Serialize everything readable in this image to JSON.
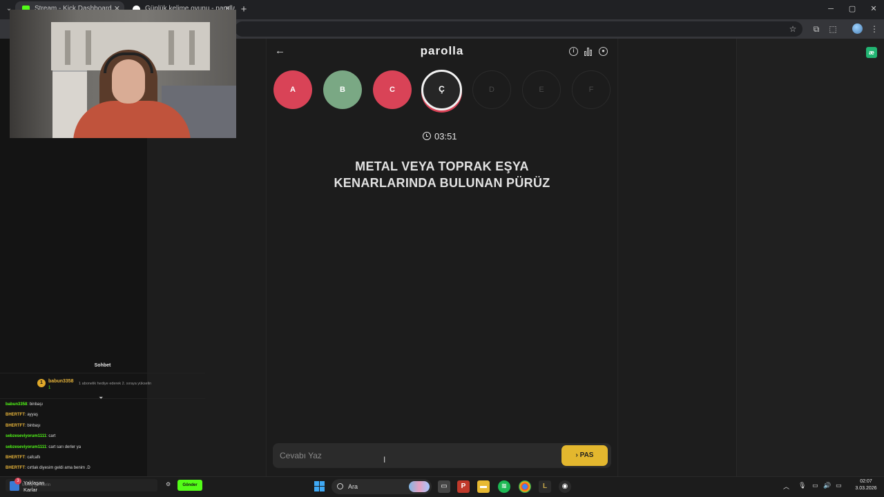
{
  "browser": {
    "tabs": [
      {
        "title": "Stream - Kick Dashboard",
        "favicon_color": "#53fc18",
        "active": true
      },
      {
        "title": "Günlük kelime oyunu - parolla",
        "favicon_color": "#ffffff",
        "active": false
      }
    ],
    "new_tab_label": "+",
    "window_controls": {
      "minimize": "─",
      "maximize": "▢",
      "close": "✕"
    }
  },
  "extension_badge": "æ",
  "webcam": {
    "description_icon": "webcam-feed"
  },
  "chat": {
    "title": "Sohbet",
    "pinned": {
      "badge": "1",
      "user": "babun3358",
      "count": "1",
      "message": "1 abonelik hediye ederek 2. sıraya yükselin"
    },
    "messages": [
      {
        "user": "babun3358",
        "color": "#53fc18",
        "text": ": binbaşı"
      },
      {
        "user": "BHERTFT",
        "color": "#e7b43a",
        "text": ": ayyaş"
      },
      {
        "user": "BHERTFT",
        "color": "#e7b43a",
        "text": ": binbaşı"
      },
      {
        "user": "sebzeseviyorum1111",
        "color": "#53fc18",
        "text": ": cart"
      },
      {
        "user": "sebzeseviyorum1111",
        "color": "#53fc18",
        "text": ": cart sarı derler ya"
      },
      {
        "user": "BHERTFT",
        "color": "#e7b43a",
        "text": ": cafcaflı"
      },
      {
        "user": "BHERTFT",
        "color": "#e7b43a",
        "text": ": cırtlak diyesim geldi ama benim .D"
      }
    ],
    "input_placeholder": "Mesaj gönderin",
    "send_label": "Gönder"
  },
  "game": {
    "title": "parolla",
    "letters": [
      {
        "letter": "A",
        "state": "wrong"
      },
      {
        "letter": "B",
        "state": "right"
      },
      {
        "letter": "C",
        "state": "wrong"
      },
      {
        "letter": "Ç",
        "state": "current"
      },
      {
        "letter": "D",
        "state": "pending"
      },
      {
        "letter": "E",
        "state": "pending"
      },
      {
        "letter": "F",
        "state": "pending"
      }
    ],
    "timer": "03:51",
    "question_line1": "METAL VEYA TOPRAK EŞYA",
    "question_line2": "KENARLARINDA BULUNAN PÜRÜZ",
    "answer_placeholder": "Cevabı Yaz",
    "pass_label": "PAS",
    "colors": {
      "wrong": "#d94357",
      "right": "#7aa884",
      "pass": "#e3b72e"
    }
  },
  "taskbar": {
    "weather_line1": "Yaklaşan",
    "weather_line2": "Karlar",
    "weather_badge": "3",
    "search_label": "Ara",
    "time": "02:07",
    "date": "3.03.2026"
  }
}
